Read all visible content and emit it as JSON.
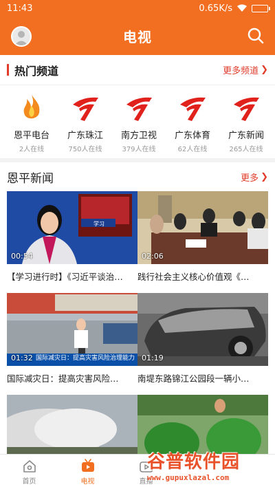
{
  "status": {
    "time": "11:43",
    "speed": "0.65K/s"
  },
  "header": {
    "title": "电视"
  },
  "hot": {
    "title": "热门频道",
    "more": "更多频道",
    "channels": [
      {
        "name": "恩平电台",
        "count": "2人在线",
        "icon": "flame-logo-icon"
      },
      {
        "name": "广东珠江",
        "count": "750人在线",
        "icon": "gdtv-logo-icon"
      },
      {
        "name": "南方卫视",
        "count": "379人在线",
        "icon": "gdtv-logo-icon"
      },
      {
        "name": "广东体育",
        "count": "62人在线",
        "icon": "gdtv-logo-icon"
      },
      {
        "name": "广东新闻",
        "count": "265人在线",
        "icon": "gdtv-logo-icon"
      }
    ]
  },
  "news": {
    "title": "恩平新闻",
    "more": "更多",
    "items": [
      {
        "duration": "00:54",
        "caption": "【学习进行时】《习近平谈治…",
        "overlay": "学习"
      },
      {
        "duration": "02:06",
        "caption": "践行社会主义核心价值观《…"
      },
      {
        "duration": "01:32",
        "caption": "国际减灾日：提高灾害风险…",
        "overlay": "国际减灾日：提高灾害风险治理能力"
      },
      {
        "duration": "01:19",
        "caption": "南堤东路锦江公园段一辆小…"
      },
      {
        "duration": "",
        "caption": ""
      },
      {
        "duration": "",
        "caption": ""
      }
    ]
  },
  "tabs": [
    {
      "label": "首页",
      "icon": "home-icon"
    },
    {
      "label": "电视",
      "icon": "tv-icon",
      "active": true
    },
    {
      "label": "直播",
      "icon": "live-icon"
    }
  ],
  "watermark": {
    "text": "谷普软件园",
    "url": "www.gupuxlazal.com"
  },
  "colors": {
    "accent": "#f26f21",
    "red": "#e23b2a"
  }
}
